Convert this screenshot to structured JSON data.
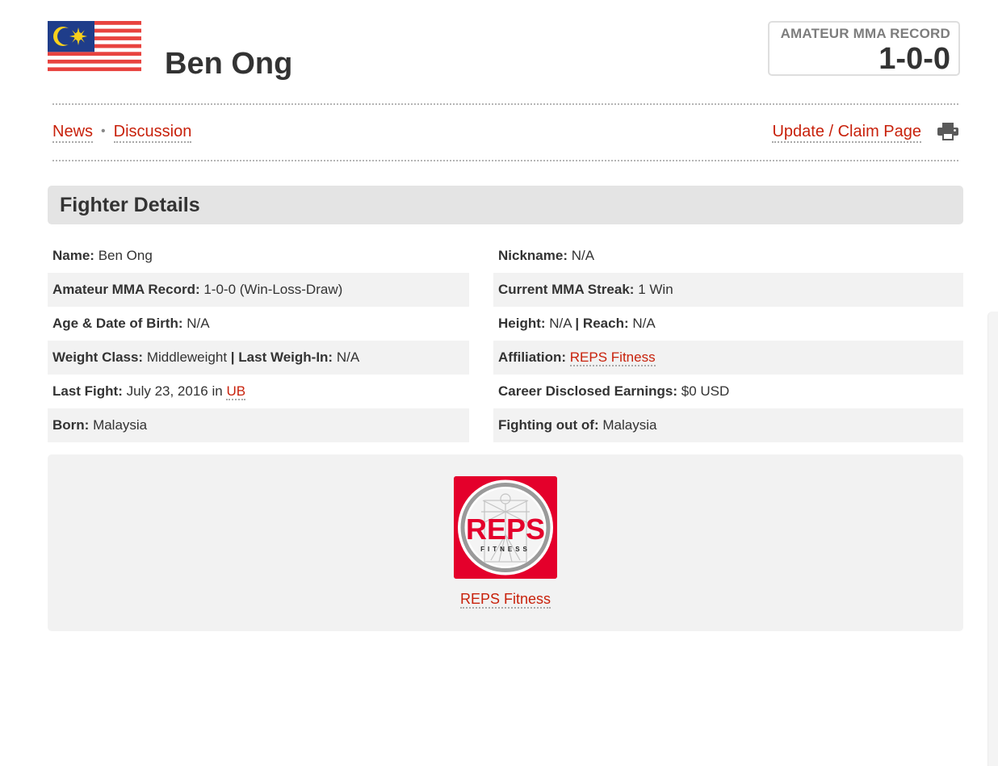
{
  "header": {
    "fighter_name": "Ben Ong",
    "flag_icon": "malaysia-flag-icon",
    "record_label": "AMATEUR MMA RECORD",
    "record_value": "1-0-0"
  },
  "nav": {
    "news": "News",
    "separator": "•",
    "discussion": "Discussion",
    "update_claim": "Update / Claim Page",
    "print_icon": "printer-icon"
  },
  "section": {
    "title": "Fighter Details"
  },
  "details_left": [
    {
      "key": "Name:",
      "value": "Ben Ong"
    },
    {
      "key": "Amateur MMA Record:",
      "value": "1-0-0 (Win-Loss-Draw)"
    },
    {
      "key": "Age & Date of Birth:",
      "value": "N/A"
    },
    {
      "key": "Weight Class:",
      "value": "Middleweight",
      "sep": "|",
      "key2": "Last Weigh-In:",
      "value2": "N/A"
    },
    {
      "key": "Last Fight:",
      "value": "July 23, 2016 in",
      "link": "UB"
    },
    {
      "key": "Born:",
      "value": "Malaysia"
    }
  ],
  "details_right": [
    {
      "key": "Nickname:",
      "value": "N/A"
    },
    {
      "key": "Current MMA Streak:",
      "value": "1 Win"
    },
    {
      "key": "Height:",
      "value": "N/A",
      "sep": "|",
      "key2": "Reach:",
      "value2": "N/A"
    },
    {
      "key": "Affiliation:",
      "link": "REPS Fitness"
    },
    {
      "key": "Career Disclosed Earnings:",
      "value": "$0 USD"
    },
    {
      "key": "Fighting out of:",
      "value": "Malaysia"
    }
  ],
  "affiliation": {
    "logo_text": "REPS",
    "logo_subtext": "FITNESS",
    "name": "REPS Fitness"
  },
  "colors": {
    "link_red": "#c8210b",
    "logo_red": "#e4002b",
    "row_alt": "#f2f2f2",
    "header_gray": "#e4e4e4"
  }
}
